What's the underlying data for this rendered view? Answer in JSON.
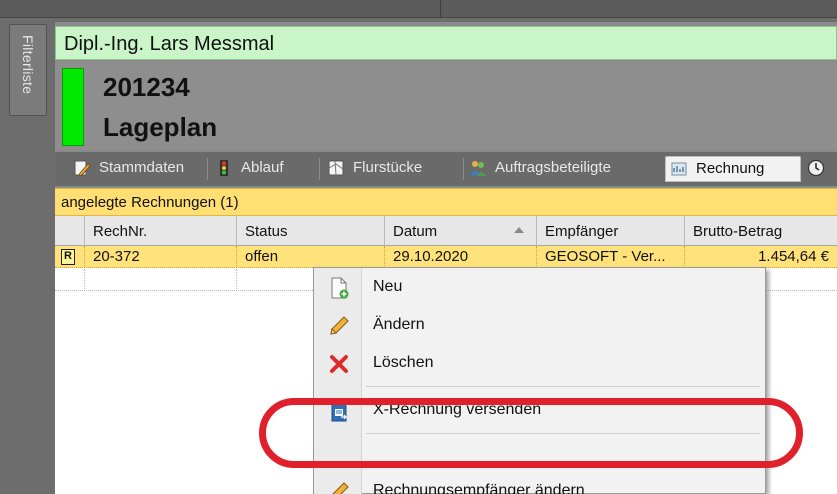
{
  "side_panel": {
    "label": "Filterliste"
  },
  "header": {
    "customer_name": "Dipl.-Ing. Lars Messmal",
    "project_number": "201234",
    "project_name": "Lageplan",
    "status_color": "#00ea00"
  },
  "tabs": [
    {
      "label": "Stammdaten",
      "icon": "pencil-doc-icon"
    },
    {
      "label": "Ablauf",
      "icon": "traffic-light-icon"
    },
    {
      "label": "Flurstücke",
      "icon": "map-parcel-icon"
    },
    {
      "label": "Auftragsbeteiligte",
      "icon": "people-icon"
    },
    {
      "label": "Rechnung",
      "icon": "invoice-icon",
      "active": true
    },
    {
      "label": "",
      "icon": "clock-icon"
    }
  ],
  "section": {
    "title": "angelegte Rechnungen (1)"
  },
  "table": {
    "columns": [
      "RechNr.",
      "Status",
      "Datum",
      "Empfänger",
      "Brutto-Betrag"
    ],
    "sorted_column": "Datum",
    "rows": [
      {
        "icon": "R",
        "rechnr": "20-372",
        "status": "offen",
        "datum": "29.10.2020",
        "empfaenger": "GEOSOFT - Ver...",
        "betrag": "1.454,64 €"
      }
    ]
  },
  "context_menu": {
    "items": [
      {
        "label": "Neu",
        "icon": "new-document-icon"
      },
      {
        "label": "Ändern",
        "icon": "pencil-icon"
      },
      {
        "label": "Löschen",
        "icon": "delete-x-icon"
      },
      {
        "label": "X-Rechnung versenden",
        "icon": "send-xinvoice-icon"
      },
      {
        "label": "Rechnungsempfänger ändern",
        "icon": "pencil-icon"
      }
    ]
  },
  "colors": {
    "highlight": "#e0202a",
    "name_bar": "#c9f5c9",
    "section_bar": "#ffdf73",
    "selected_row": "#ffe27a"
  }
}
